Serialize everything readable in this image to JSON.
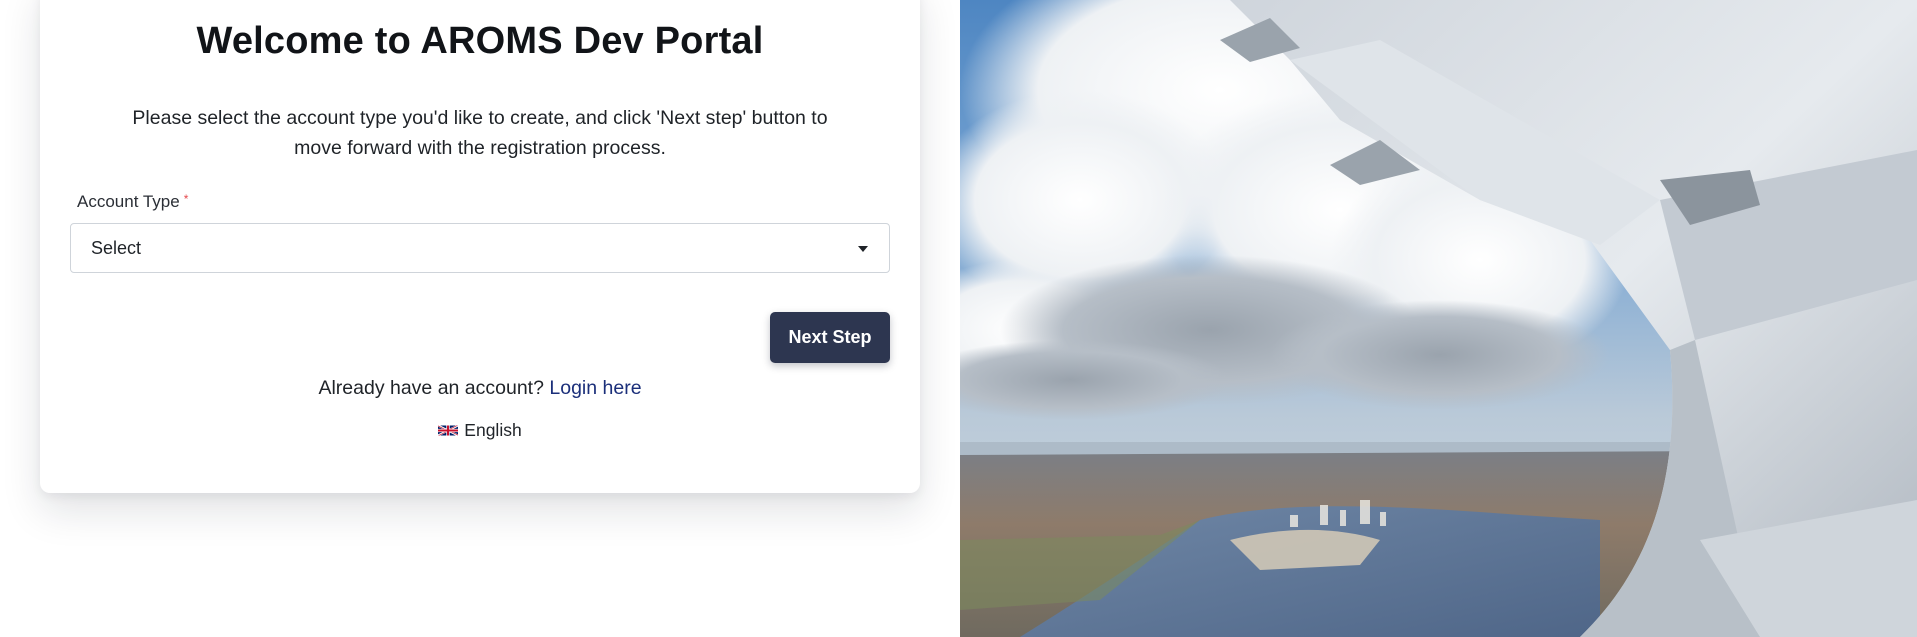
{
  "card": {
    "title": "Welcome to AROMS Dev Portal",
    "intro": "Please select the account type you'd like to create, and click 'Next step' button to move forward with the registration process."
  },
  "account_type": {
    "label": "Account Type",
    "required_marker": "*",
    "selected_value": "Select"
  },
  "actions": {
    "next_label": "Next Step"
  },
  "login": {
    "prompt": "Already have an account?",
    "link_label": "Login here"
  },
  "language": {
    "current": "English",
    "flag_icon": "uk-flag-icon"
  },
  "colors": {
    "primary_button": "#2d3650",
    "link": "#1b2f7a",
    "required": "#e5484d"
  }
}
